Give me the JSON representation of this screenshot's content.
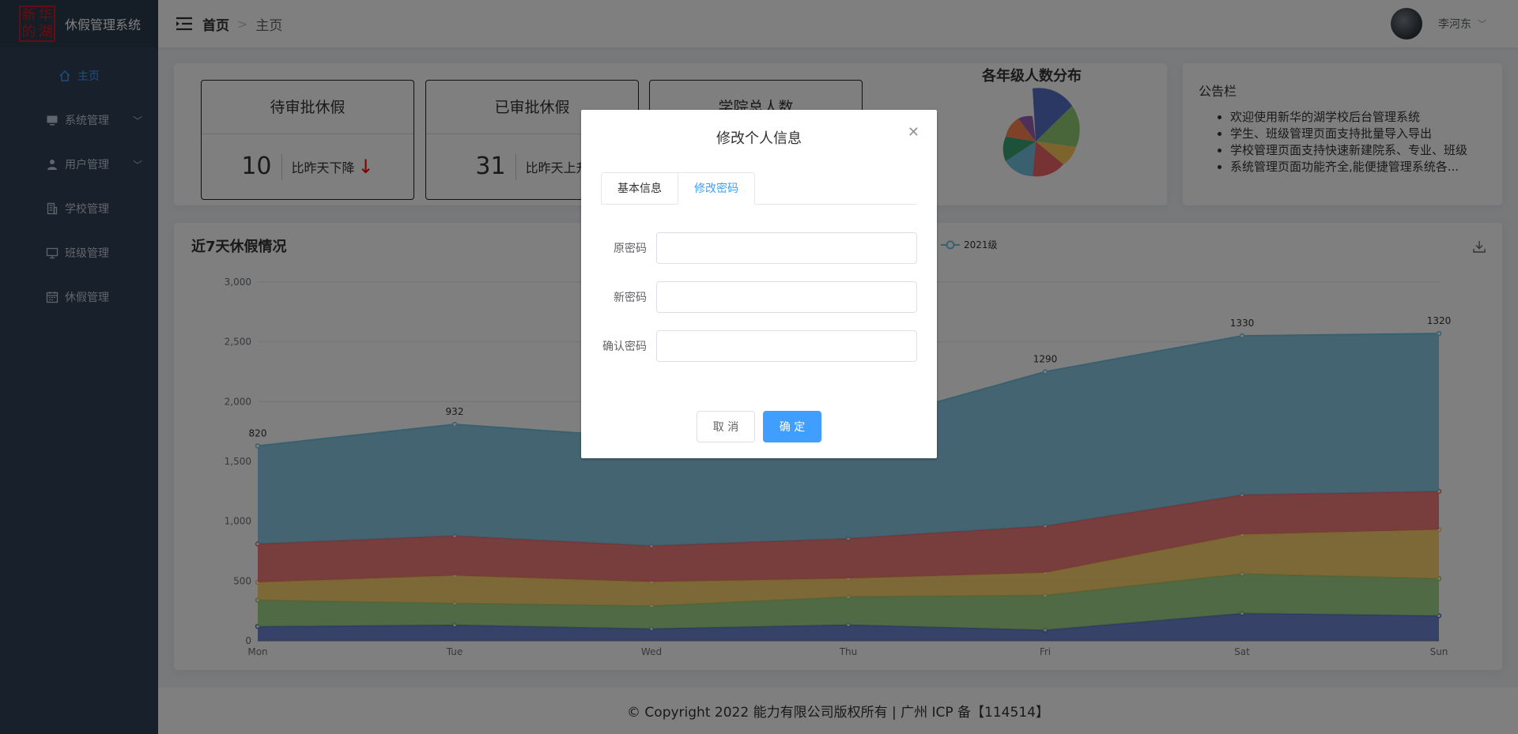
{
  "brand": {
    "logo_chars": [
      "新",
      "华",
      "的",
      "湖"
    ],
    "title": "休假管理系统"
  },
  "sidebar": {
    "items": [
      {
        "label": "主页",
        "icon": "home-icon"
      },
      {
        "label": "系统管理",
        "icon": "monitor-icon"
      },
      {
        "label": "用户管理",
        "icon": "user-icon"
      },
      {
        "label": "学校管理",
        "icon": "building-icon"
      },
      {
        "label": "班级管理",
        "icon": "screen-icon"
      },
      {
        "label": "休假管理",
        "icon": "calendar-icon"
      }
    ]
  },
  "header": {
    "breadcrumb_home": "首页",
    "breadcrumb_separator": ">",
    "breadcrumb_current": "主页",
    "username": "李河东"
  },
  "stats": [
    {
      "title": "待审批休假",
      "value": "10",
      "compare": "比昨天下降"
    },
    {
      "title": "已审批休假",
      "value": "31",
      "compare": "比昨天上升"
    },
    {
      "title": "学院总人数",
      "value": "",
      "compare": ""
    }
  ],
  "pie": {
    "title": "各年级人数分布"
  },
  "notice": {
    "title": "公告栏",
    "items": [
      "欢迎使用新华的湖学校后台管理系统",
      "学生、班级管理页面支持批量导入导出",
      "学校管理页面支持快速新建院系、专业、班级",
      "系统管理页面功能齐全,能便捷管理系统各..."
    ]
  },
  "chart_data": {
    "type": "area",
    "title": "近7天休假情况",
    "categories": [
      "Mon",
      "Tue",
      "Wed",
      "Thu",
      "Fri",
      "Sat",
      "Sun"
    ],
    "stacked": true,
    "ylim": [
      0,
      3000
    ],
    "yticks": [
      "0",
      "500",
      "1,000",
      "1,500",
      "2,000",
      "2,500",
      "3,000"
    ],
    "grid": true,
    "legend": {
      "visible_entries": [
        "2021级"
      ],
      "position": "top"
    },
    "series": [
      {
        "color": "#5470c6",
        "values": [
          120,
          132,
          101,
          134,
          90,
          230,
          210
        ]
      },
      {
        "color": "#91cc75",
        "values": [
          220,
          182,
          191,
          234,
          290,
          330,
          310
        ]
      },
      {
        "color": "#fac858",
        "values": [
          150,
          232,
          201,
          154,
          190,
          330,
          410
        ]
      },
      {
        "color": "#ee6666",
        "values": [
          320,
          332,
          301,
          334,
          390,
          330,
          320
        ]
      },
      {
        "name": "2021级",
        "color": "#73c0de",
        "values": [
          820,
          932,
          901,
          934,
          1290,
          1330,
          1320
        ]
      }
    ],
    "top_labels": [
      "820",
      "932",
      "",
      "",
      "1290",
      "1330",
      "1320"
    ]
  },
  "footer": {
    "copyright": "© Copyright 2022 能力有限公司版权所有 | 广州 ICP 备【114514】"
  },
  "dialog": {
    "title": "修改个人信息",
    "tabs": [
      "基本信息",
      "修改密码"
    ],
    "active_tab": "修改密码",
    "fields": [
      {
        "label": "原密码",
        "value": ""
      },
      {
        "label": "新密码",
        "value": ""
      },
      {
        "label": "确认密码",
        "value": ""
      }
    ],
    "cancel_label": "取 消",
    "ok_label": "确 定"
  },
  "colors": {
    "accent": "#409eff",
    "sidebar": "#304156",
    "down_arrow": "#ee0000"
  }
}
